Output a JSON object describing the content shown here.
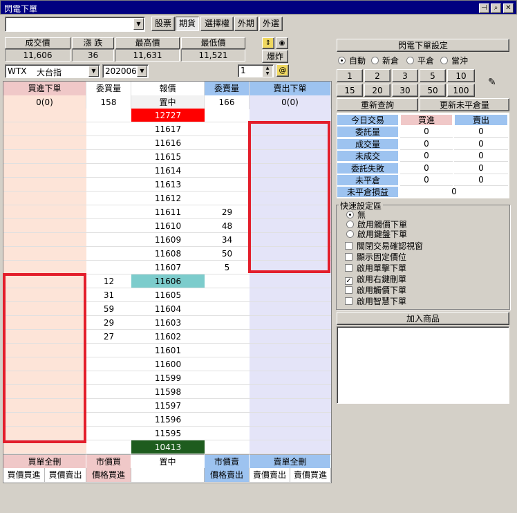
{
  "window": {
    "title": "閃電下單"
  },
  "top_tabs": [
    "股票",
    "期貨",
    "選擇權",
    "外期",
    "外選"
  ],
  "quote_header": {
    "labels": [
      "成交價",
      "漲 跌",
      "最高價",
      "最低價"
    ],
    "values": [
      "11,606",
      "36",
      "11,631",
      "11,521"
    ]
  },
  "explode_label": "爆炸",
  "product": {
    "code": "WTX",
    "name": "大台指",
    "month": "202006",
    "qty": "1"
  },
  "ladder": {
    "headers": {
      "buy": "買進下單",
      "bid_qty": "委買量",
      "price": "報價",
      "ask_qty": "委賣量",
      "sell": "賣出下單"
    },
    "summary": {
      "buy": "0(0)",
      "bid_qty": "158",
      "price": "置中",
      "ask_qty": "166",
      "sell": "0(0)"
    },
    "rows": [
      {
        "price": "12727",
        "bid": "",
        "ask": ""
      },
      {
        "price": "11617",
        "bid": "",
        "ask": ""
      },
      {
        "price": "11616",
        "bid": "",
        "ask": ""
      },
      {
        "price": "11615",
        "bid": "",
        "ask": ""
      },
      {
        "price": "11614",
        "bid": "",
        "ask": ""
      },
      {
        "price": "11613",
        "bid": "",
        "ask": ""
      },
      {
        "price": "11612",
        "bid": "",
        "ask": ""
      },
      {
        "price": "11611",
        "bid": "",
        "ask": "29"
      },
      {
        "price": "11610",
        "bid": "",
        "ask": "48"
      },
      {
        "price": "11609",
        "bid": "",
        "ask": "34"
      },
      {
        "price": "11608",
        "bid": "",
        "ask": "50"
      },
      {
        "price": "11607",
        "bid": "",
        "ask": "5"
      },
      {
        "price": "11606",
        "bid": "12",
        "ask": ""
      },
      {
        "price": "11605",
        "bid": "31",
        "ask": ""
      },
      {
        "price": "11604",
        "bid": "59",
        "ask": ""
      },
      {
        "price": "11603",
        "bid": "29",
        "ask": ""
      },
      {
        "price": "11602",
        "bid": "27",
        "ask": ""
      },
      {
        "price": "11601",
        "bid": "",
        "ask": ""
      },
      {
        "price": "11600",
        "bid": "",
        "ask": ""
      },
      {
        "price": "11599",
        "bid": "",
        "ask": ""
      },
      {
        "price": "11598",
        "bid": "",
        "ask": ""
      },
      {
        "price": "11597",
        "bid": "",
        "ask": ""
      },
      {
        "price": "11596",
        "bid": "",
        "ask": ""
      },
      {
        "price": "11595",
        "bid": "",
        "ask": ""
      },
      {
        "price": "10413",
        "bid": "",
        "ask": ""
      }
    ],
    "footer1": {
      "buy_all": "買單全刪",
      "mkt_buy": "市價買",
      "center": "置中",
      "mkt_sell": "市價賣",
      "sell_all": "賣單全刪"
    },
    "footer2": [
      "買價買進",
      "買價賣出",
      "價格買進",
      "",
      "價格賣出",
      "賣價賣出",
      "賣價買進"
    ]
  },
  "colors": {
    "limit_up": "#ff0000",
    "last": "#7ccccc",
    "limit_down": "#1e5c1e",
    "buy_bg": "#fde4d8",
    "sell_bg": "#e4e4f8",
    "buy_hdr": "#f0c8c8",
    "sell_hdr": "#9dc3f0",
    "highlight": "#e31e2b"
  },
  "settings": {
    "title": "閃電下單設定",
    "modes": [
      "自動",
      "新倉",
      "平倉",
      "當沖"
    ],
    "qty_row1": [
      "1",
      "2",
      "3",
      "5",
      "10"
    ],
    "qty_row2": [
      "15",
      "20",
      "30",
      "50",
      "100"
    ],
    "requery": "重新查詢",
    "update_open": "更新未平倉量"
  },
  "stats": {
    "header": [
      "今日交易",
      "買進",
      "賣出"
    ],
    "rows": [
      {
        "label": "委託量",
        "buy": "0",
        "sell": "0"
      },
      {
        "label": "成交量",
        "buy": "0",
        "sell": "0"
      },
      {
        "label": "未成交",
        "buy": "0",
        "sell": "0"
      },
      {
        "label": "委託失敗",
        "buy": "0",
        "sell": "0"
      },
      {
        "label": "未平倉",
        "buy": "0",
        "sell": "0"
      }
    ],
    "pnl_label": "未平倉損益",
    "pnl_value": "0"
  },
  "quick": {
    "title": "快速設定區",
    "radios": [
      "無",
      "啟用觸價下單",
      "啟用鍵盤下單"
    ],
    "checks": [
      {
        "label": "關閉交易確認視窗",
        "checked": false
      },
      {
        "label": "顯示固定價位",
        "checked": false
      },
      {
        "label": "啟用單擊下單",
        "checked": false
      },
      {
        "label": "啟用右鍵刪單",
        "checked": true
      },
      {
        "label": "啟用觸價下單",
        "checked": false
      },
      {
        "label": "啟用智慧下單",
        "checked": false
      }
    ]
  },
  "add_product": "加入商品"
}
